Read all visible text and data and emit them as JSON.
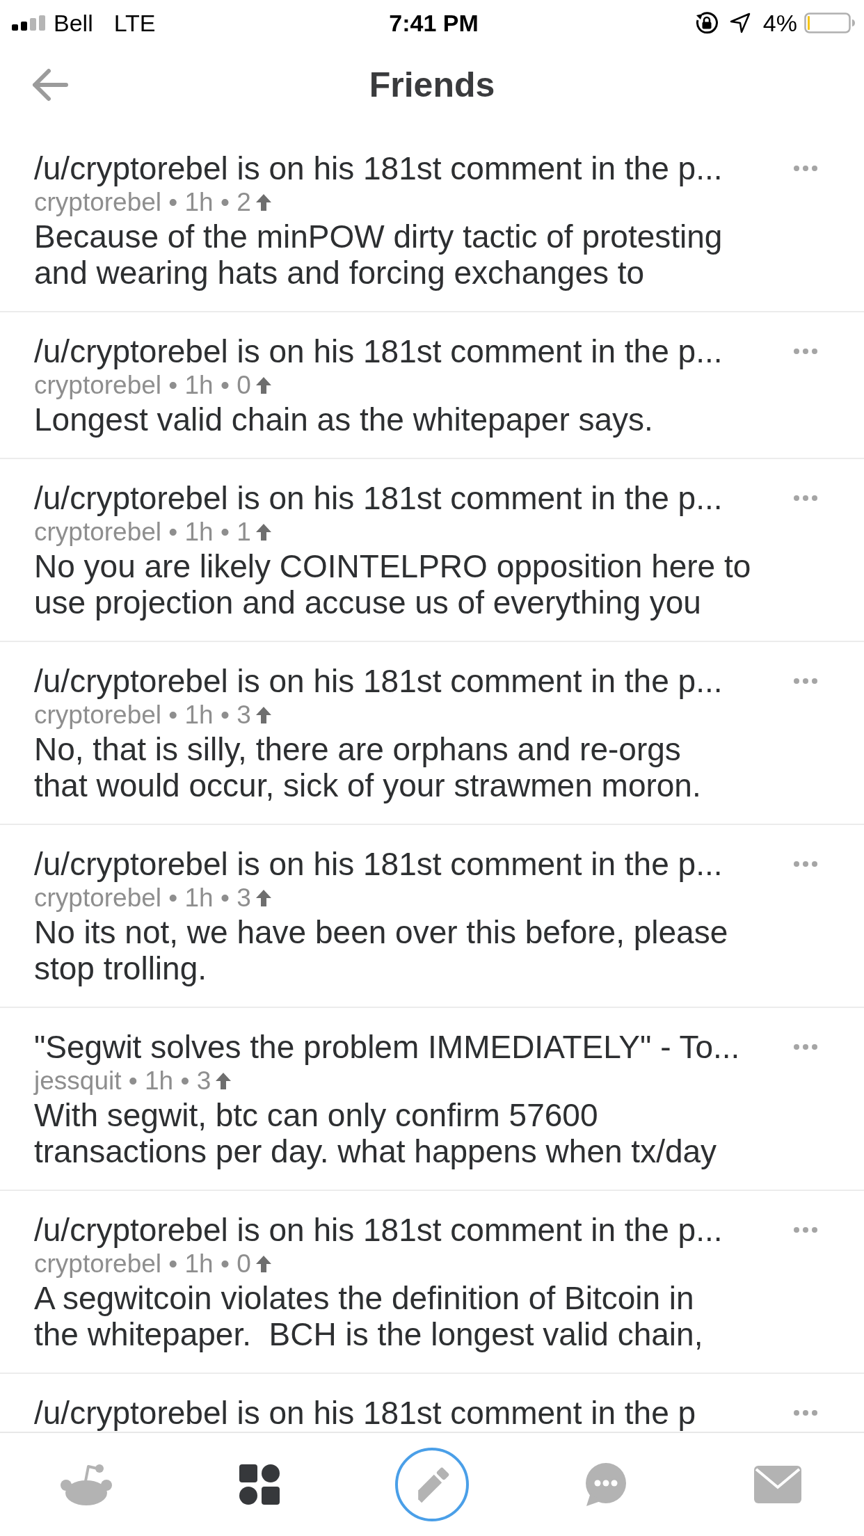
{
  "status_bar": {
    "carrier": "Bell",
    "network": "LTE",
    "time": "7:41 PM",
    "battery": "4%"
  },
  "header": {
    "title": "Friends"
  },
  "feed": [
    {
      "title": "/u/cryptorebel is on his 181st comment in the p...",
      "byline": "cryptorebel • 1h • 2",
      "body": "Because of the minPOW dirty tactic of protesting\nand wearing hats and forcing exchanges to"
    },
    {
      "title": "/u/cryptorebel is on his 181st comment in the p...",
      "byline": "cryptorebel • 1h • 0",
      "body": "Longest valid chain as the whitepaper says."
    },
    {
      "title": "/u/cryptorebel is on his 181st comment in the p...",
      "byline": "cryptorebel • 1h • 1",
      "body": "No you are likely COINTELPRO opposition here to\nuse projection and accuse us of everything you"
    },
    {
      "title": "/u/cryptorebel is on his 181st comment in the p...",
      "byline": "cryptorebel • 1h • 3",
      "body": "No, that is silly, there are orphans and re-orgs\nthat would occur, sick of your strawmen moron."
    },
    {
      "title": "/u/cryptorebel is on his 181st comment in the p...",
      "byline": "cryptorebel • 1h • 3",
      "body": "No its not, we have been over this before, please\nstop trolling."
    },
    {
      "title": "\"Segwit solves the problem IMMEDIATELY\" - To...",
      "byline": "jessquit • 1h • 3",
      "body": "With segwit, btc can only confirm 57600\ntransactions per day. what happens when tx/day"
    },
    {
      "title": "/u/cryptorebel is on his 181st comment in the p...",
      "byline": "cryptorebel • 1h • 0",
      "body": "A segwitcoin violates the definition of Bitcoin in\nthe whitepaper.  BCH is the longest valid chain,"
    },
    {
      "title": "/u/cryptorebel is on his 181st comment in the p"
    }
  ],
  "tab_bar": [
    {
      "kind": "tab",
      "selected": false
    },
    {
      "kind": "tab",
      "selected": true
    },
    {
      "kind": "compose",
      "selected": false
    },
    {
      "kind": "tab",
      "selected": false
    },
    {
      "kind": "tab",
      "selected": false
    }
  ]
}
